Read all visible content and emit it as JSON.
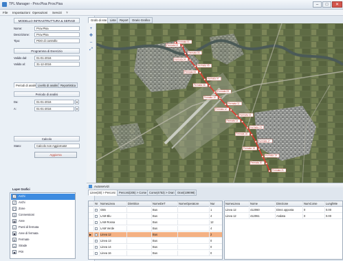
{
  "window": {
    "title": "TPL Manager - Prov.Pisa Prov.Pisa",
    "minimize": "–",
    "maximize": "□",
    "close": "✕"
  },
  "menu": [
    "File",
    "Impostazioni",
    "Operazioni",
    "Servizi",
    "?"
  ],
  "left": {
    "modello_title": "MODELLO INFRASTRUTTURA & SERVIZI",
    "nome_label": "Nome:",
    "nome_value": "Prov.Pisa",
    "descrizione_label": "Descrizione:",
    "descrizione_value": "Prov.Pisa",
    "tipo_label": "Tipo:",
    "tipo_value": "PDO di controllo",
    "programma_title": "Programma di Esercizio",
    "valido_dal_label": "Valido dal:",
    "valido_dal_value": "01-01-2016",
    "valido_al_label": "Valido al:",
    "valido_al_value": "31-12-2016",
    "tabs": [
      "Periodi di analisi",
      "Livello di analisi",
      "Reportistica"
    ],
    "periodo_title": "Periodo di analisi",
    "da_label": "Da:",
    "da_value": "01-01-2016",
    "a_label": "A:",
    "a_value": "01-01-2016",
    "calcolo_title": "Calcolo",
    "stato_label": "Stato:",
    "stato_value": "Calcolo non Aggiornato!",
    "aggiorna": "Aggiorna",
    "layer_title": "Layer Grafici",
    "layers": [
      "Archi",
      "Archi",
      "Zone",
      "Connessioni",
      "Aree",
      "Punti di fermata",
      "Aree di fermata",
      "Fermate",
      "Strade",
      "POI"
    ]
  },
  "map": {
    "tabs": [
      "Grafo di rete",
      "Liste",
      "Report",
      "Orario Grafico"
    ],
    "tools": {
      "zoom_in": "+",
      "pan": "✥",
      "zoom_out": "–",
      "fit": "⤢"
    },
    "route_color": "#e03a2f",
    "stop_labels": [
      "Fermata 01",
      "Fermata 02",
      "Fermata 03",
      "Fermata 04",
      "Fermata 05",
      "Fermata 06",
      "Fermata 07",
      "Fermata 08",
      "Fermata 09",
      "Fermata 10",
      "Fermata 11",
      "Fermata 12",
      "Fermata 13",
      "Fermata 14",
      "Fermata 15",
      "Fermata 16",
      "Fermata 17",
      "Fermata 18",
      "Fermata 19",
      "Fermata 20",
      "Fermata 21"
    ]
  },
  "bottom": {
    "header": "Autoservizi",
    "tabs": [
      "Linee(30) > Percorsi",
      "Percorsi(205) > Corse",
      "Corse(4753) > Orari",
      "Orari(109098)"
    ],
    "grid1": {
      "columns": [
        "",
        "Nr",
        "NomeLinea",
        "Direttrice",
        "NomeDeT",
        "NomeOperatore",
        "Nur"
      ],
      "rows": [
        [
          "",
          "",
          "G55",
          "",
          "Bus",
          "",
          "1"
        ],
        [
          "",
          "",
          "LAM Blu",
          "",
          "Bus",
          "",
          "4"
        ],
        [
          "",
          "",
          "LAM Rossa",
          "",
          "Bus",
          "",
          "12"
        ],
        [
          "",
          "",
          "LAM Verde",
          "",
          "Bus",
          "",
          "4"
        ],
        [
          "▶",
          "",
          "Linea 12",
          "",
          "Bus",
          "",
          "2"
        ],
        [
          "",
          "",
          "Linea 13",
          "",
          "Bus",
          "",
          "0"
        ],
        [
          "",
          "",
          "Linea 14",
          "",
          "Bus",
          "",
          "0"
        ],
        [
          "",
          "",
          "Linea 16",
          "",
          "Bus",
          "",
          "0"
        ]
      ],
      "selected_row": 4
    },
    "grid2": {
      "columns": [
        "NomeLinea",
        "Nome",
        "Direzione",
        "NumCorse",
        "LunghMe"
      ],
      "rows": [
        [
          "Linea 12",
          "412060",
          "Direz.opposta",
          "0",
          "0.00"
        ],
        [
          "Linea 12",
          "412061",
          "Andata",
          "0",
          "0.00"
        ]
      ]
    }
  }
}
